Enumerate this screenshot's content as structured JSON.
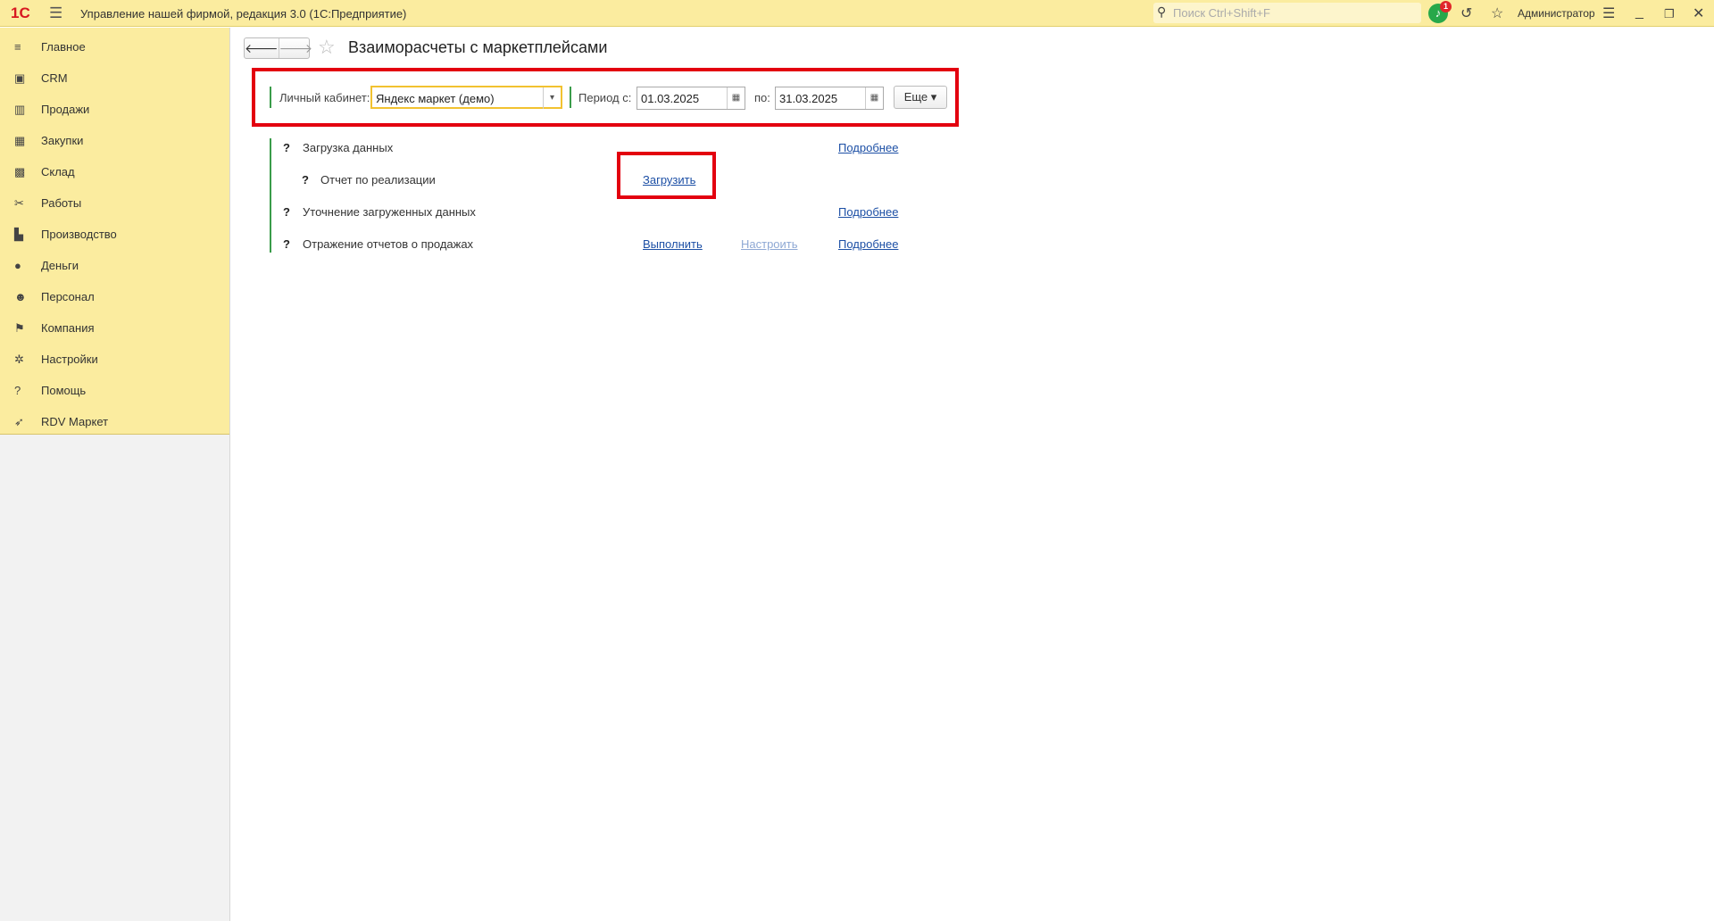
{
  "app": {
    "logo": "1С",
    "title": "Управление нашей фирмой, редакция 3.0  (1С:Предприятие)",
    "search_placeholder": "Поиск Ctrl+Shift+F",
    "notifications": "1",
    "user": "Администратор"
  },
  "sidebar": {
    "items": [
      {
        "label": "Главное",
        "icon": "menu-icon",
        "glyph": "≡"
      },
      {
        "label": "CRM",
        "icon": "contact-card-icon",
        "glyph": "▣"
      },
      {
        "label": "Продажи",
        "icon": "basket-icon",
        "glyph": "▥"
      },
      {
        "label": "Закупки",
        "icon": "cart-icon",
        "glyph": "▦"
      },
      {
        "label": "Склад",
        "icon": "warehouse-icon",
        "glyph": "▩"
      },
      {
        "label": "Работы",
        "icon": "tools-icon",
        "glyph": "✂"
      },
      {
        "label": "Производство",
        "icon": "factory-icon",
        "glyph": "▙"
      },
      {
        "label": "Деньги",
        "icon": "money-icon",
        "glyph": "●"
      },
      {
        "label": "Персонал",
        "icon": "people-icon",
        "glyph": "☻"
      },
      {
        "label": "Компания",
        "icon": "flag-icon",
        "glyph": "⚑"
      },
      {
        "label": "Настройки",
        "icon": "gear-icon",
        "glyph": "✲"
      },
      {
        "label": "Помощь",
        "icon": "help-icon",
        "glyph": "?"
      },
      {
        "label": "RDV Маркет",
        "icon": "rocket-icon",
        "glyph": "➶"
      }
    ]
  },
  "page": {
    "title": "Взаиморасчеты с маркетплейсами",
    "filters": {
      "account_label": "Личный кабинет:",
      "account_value": "Яндекс маркет (демо)",
      "period_from_label": "Период с:",
      "period_from": "01.03.2025",
      "period_to_label": "по:",
      "period_to": "31.03.2025",
      "more_label": "Еще"
    },
    "steps": [
      {
        "q": "?",
        "label": "Загрузка данных",
        "details": "Подробнее"
      },
      {
        "q": "?",
        "label": "Отчет по реализации",
        "action": "Загрузить"
      },
      {
        "q": "?",
        "label": "Уточнение загруженных данных",
        "details": "Подробнее"
      },
      {
        "q": "?",
        "label": "Отражение отчетов о продажах",
        "action": "Выполнить",
        "configure": "Настроить",
        "details": "Подробнее"
      }
    ]
  },
  "colors": {
    "accent": "#fbec9f",
    "highlight": "#e3000f",
    "link": "#1c4fa5",
    "group_bar": "#3a9c4a"
  }
}
